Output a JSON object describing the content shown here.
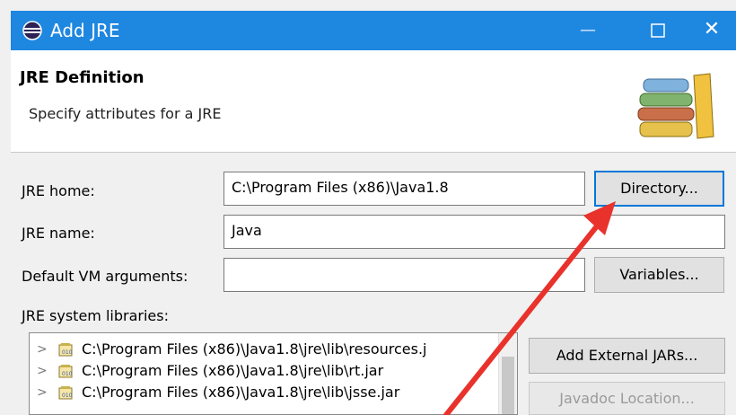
{
  "window": {
    "title": "Add JRE",
    "minimize": "—",
    "close": "✕"
  },
  "header": {
    "title": "JRE Definition",
    "description": "Specify attributes for a JRE"
  },
  "form": {
    "jre_home_label": "JRE home:",
    "jre_home_value": "C:\\Program Files (x86)\\Java1.8",
    "jre_name_label": "JRE name:",
    "jre_name_value": "Java",
    "vm_args_label": "Default VM arguments:",
    "vm_args_value": "",
    "libraries_label": "JRE system libraries:"
  },
  "buttons": {
    "directory": "Directory...",
    "variables": "Variables...",
    "add_external_jars": "Add External JARs...",
    "javadoc_location": "Javadoc Location..."
  },
  "libraries": [
    {
      "path": "C:\\Program Files (x86)\\Java1.8\\jre\\lib\\resources.j"
    },
    {
      "path": "C:\\Program Files (x86)\\Java1.8\\jre\\lib\\rt.jar"
    },
    {
      "path": "C:\\Program Files (x86)\\Java1.8\\jre\\lib\\jsse.jar"
    }
  ],
  "colors": {
    "titlebar": "#1e87e0",
    "annotation_arrow": "#e8322b",
    "focus": "#0078d7"
  },
  "icons": {
    "app": "eclipse-icon",
    "banner": "library-books-icon",
    "jar": "jar-icon",
    "expand": "chevron-right-icon"
  }
}
